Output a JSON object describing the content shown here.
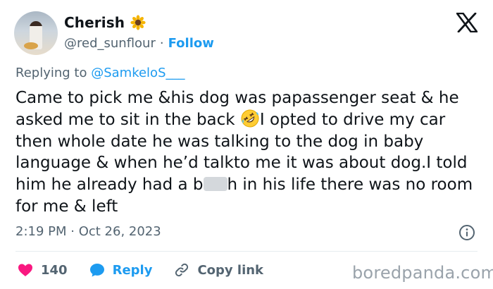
{
  "author": {
    "name": "Cherish",
    "handle": "@red_sunflour",
    "separator": "·",
    "follow_label": "Follow",
    "name_emoji": "sunflower-icon"
  },
  "reply": {
    "prefix": "Replying to ",
    "mention": "@SamkeloS___"
  },
  "tweet": {
    "part1": "Came to pick me &his dog was papassenger seat & he asked me to sit in the back ",
    "emoji": "rolling-on-floor-laughing-icon",
    "part2": "I opted to drive my car then whole date he was talking to the dog in baby language & when he’d talkto me it was about dog.I told him he already had a b",
    "part3": "h in his life there was no room for me & left"
  },
  "meta": {
    "timestamp": "2:19 PM · Oct 26, 2023"
  },
  "actions": {
    "like_count": "140",
    "reply_label": "Reply",
    "copy_link_label": "Copy link"
  },
  "watermark": "boredpanda.com",
  "colors": {
    "accent": "#1d9bf0",
    "like": "#f91880",
    "muted": "#536471",
    "text": "#0f1419"
  }
}
